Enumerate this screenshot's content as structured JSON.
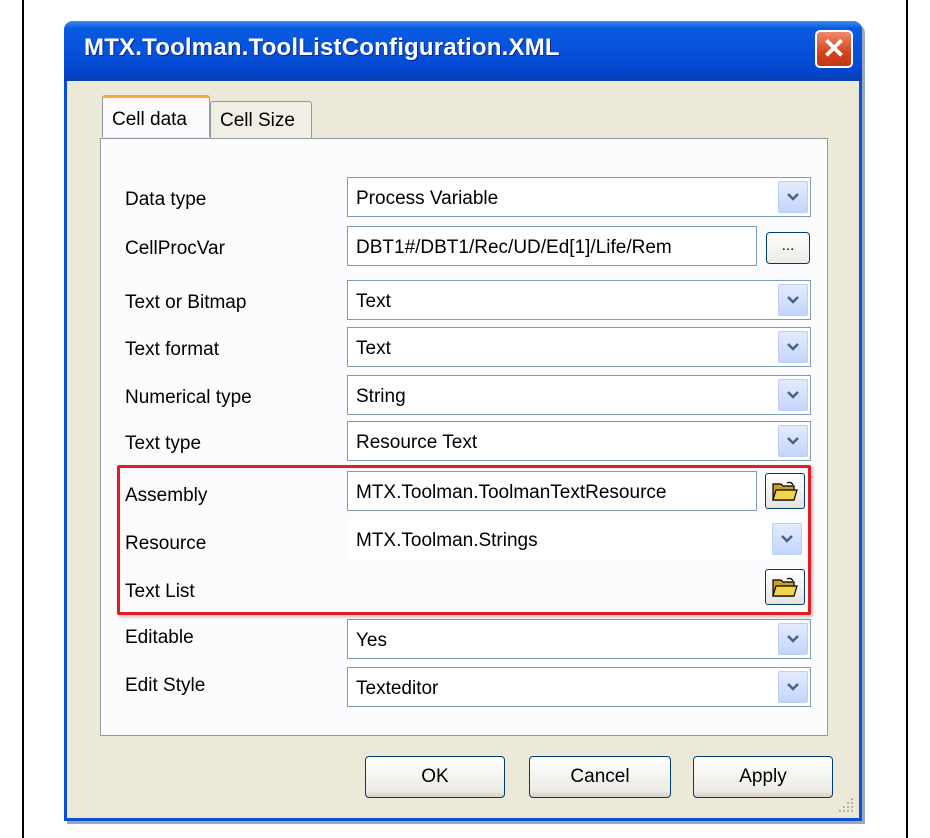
{
  "window": {
    "title": "MTX.Toolman.ToolListConfiguration.XML",
    "close_label": "✕"
  },
  "tabs": [
    {
      "label": "Cell data",
      "active": true
    },
    {
      "label": "Cell Size",
      "active": false
    }
  ],
  "fields": [
    {
      "label": "Data type",
      "control": "combo",
      "value": "Process Variable"
    },
    {
      "label": "CellProcVar",
      "control": "textbox-ellipsis",
      "value": "DBT1#/DBT1/Rec/UD/Ed[1]/Life/Rem",
      "button": "..."
    },
    {
      "label": "Text or Bitmap",
      "control": "combo",
      "value": "Text"
    },
    {
      "label": "Text format",
      "control": "combo",
      "value": "Text"
    },
    {
      "label": "Numerical type",
      "control": "combo",
      "value": "String"
    },
    {
      "label": "Text type",
      "control": "combo",
      "value": "Resource Text"
    },
    {
      "label": "Assembly",
      "control": "textbox-folder",
      "value": "MTX.Toolman.ToolmanTextResource"
    },
    {
      "label": "Resource",
      "control": "combo",
      "value": "MTX.Toolman.Strings"
    },
    {
      "label": "Text List",
      "control": "folder",
      "value": ""
    },
    {
      "label": "Editable",
      "control": "combo",
      "value": "Yes"
    },
    {
      "label": "Edit Style",
      "control": "combo",
      "value": "Texteditor"
    }
  ],
  "buttons": {
    "ok": "OK",
    "cancel": "Cancel",
    "apply": "Apply"
  },
  "colors": {
    "highlight": "#e51c23",
    "titlebar": "#0551dd"
  },
  "icons": [
    "close-icon",
    "chevron-down-icon",
    "folder-open-icon",
    "resize-grip-icon"
  ]
}
